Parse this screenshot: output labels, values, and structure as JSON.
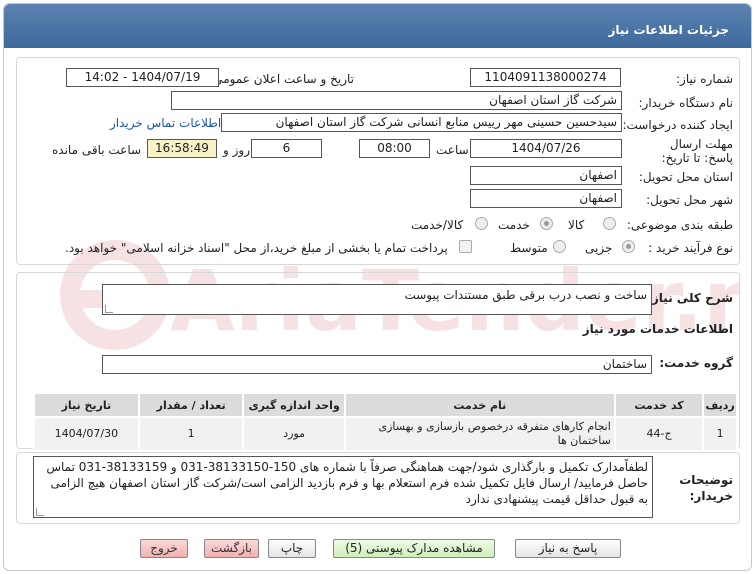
{
  "header": {
    "title": "جزئیات اطلاعات نیاز"
  },
  "form": {
    "need_number_label": "شماره نیاز:",
    "need_number": "1104091138000274",
    "announce_label": "تاریخ و ساعت اعلان عمومی:",
    "announce_value": "1404/07/19 - 14:02",
    "buyer_label": "نام دستگاه خریدار:",
    "buyer_value": "شرکت گاز استان اصفهان",
    "creator_label": "ایجاد کننده درخواست:",
    "creator_value": "سیدحسین حسینی مهر رییس منابع انسانی شرکت گاز استان اصفهان",
    "contact_link": "اطلاعات تماس خریدار",
    "deadline_label": "مهلت ارسال پاسخ: تا تاریخ:",
    "deadline_date": "1404/07/26",
    "time_label": "ساعت",
    "deadline_time": "08:00",
    "days_value": "6",
    "days_label": "روز و",
    "remaining_time": "16:58:49",
    "remaining_label": "ساعت باقی مانده",
    "province_label": "استان محل تحویل:",
    "province_value": "اصفهان",
    "city_label": "شهر محل تحویل:",
    "city_value": "اصفهان",
    "category_label": "طبقه بندی موضوعی:",
    "category_options": [
      "کالا",
      "خدمت",
      "کالا/خدمت"
    ],
    "process_label": "نوع فرآیند خرید :",
    "process_options": [
      "جزیی",
      "متوسط"
    ],
    "payment_note": "پرداخت تمام یا بخشی از مبلغ خرید،از محل \"اسناد خزانه اسلامی\" خواهد بود."
  },
  "summary": {
    "label": "شرح کلی نیاز:",
    "value": "ساخت و نصب درب برقی طبق مستندات پیوست"
  },
  "services": {
    "title": "اطلاعات خدمات مورد نیاز",
    "group_label": "گروه خدمت:",
    "group_value": "ساختمان",
    "columns": [
      "ردیف",
      "کد خدمت",
      "نام خدمت",
      "واحد اندازه گیری",
      "تعداد / مقدار",
      "تاریخ نیاز"
    ],
    "rows": [
      [
        "1",
        "ج-44",
        "انجام کارهای متفرقه درخصوص بازسازی و بهسازی ساختمان ها",
        "مورد",
        "1",
        "1404/07/30"
      ]
    ]
  },
  "notes": {
    "label": "توضیحات خریدار:",
    "value": "لطفاًمدارک تکمیل و بارگذاری شود/جهت هماهنگی صرفاً با شماره های  150-38133150-031 و 38133159-031 تماس حاصل فرمایید/ ارسال فایل تکمیل شده فرم استعلام بها و فرم بازدید الزامی است/شرکت گاز  استان اصفهان هیچ الزامی به قبول حداقل قیمت پیشنهادی ندارد"
  },
  "buttons": {
    "reply": "پاسخ به نیاز",
    "docs": "مشاهده مدارک پیوستی (5)",
    "print": "چاپ",
    "back": "بازگشت",
    "exit": "خروج"
  },
  "watermark": {
    "text": "AriaTender.net"
  },
  "colors": {
    "header": "#4a74a6",
    "link": "#1b55b0",
    "remaining_bg": "#f8f3c6"
  }
}
